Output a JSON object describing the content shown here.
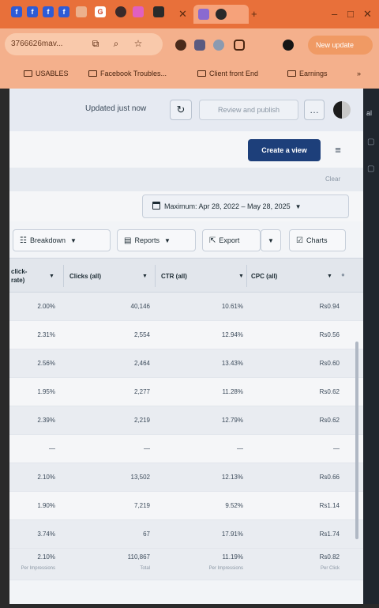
{
  "browser": {
    "url": "3766626mav...",
    "update_label": "New update",
    "bookmarks": [
      "USABLES",
      "Facebook Troubles...",
      "Client front End",
      "Earnings"
    ]
  },
  "header": {
    "status": "Updated just now",
    "publish_label": "Review and publish",
    "more_label": "…"
  },
  "create_view_label": "Create a view",
  "clear_label": "Clear",
  "date_range": "Maximum: Apr 28, 2022 – May 28, 2025",
  "toolbar": {
    "breakdown": "Breakdown",
    "reports": "Reports",
    "export": "Export",
    "charts": "Charts"
  },
  "table": {
    "columns": [
      "click-\nrate)",
      "Clicks (all)",
      "CTR (all)",
      "CPC (all)"
    ],
    "rows": [
      [
        "2.00%",
        "40,146",
        "10.61%",
        "Rs0.94"
      ],
      [
        "2.31%",
        "2,554",
        "12.94%",
        "Rs0.56"
      ],
      [
        "2.56%",
        "2,464",
        "13.43%",
        "Rs0.60"
      ],
      [
        "1.95%",
        "2,277",
        "11.28%",
        "Rs0.62"
      ],
      [
        "2.39%",
        "2,219",
        "12.79%",
        "Rs0.62"
      ],
      [
        "—",
        "—",
        "—",
        "—"
      ],
      [
        "2.10%",
        "13,502",
        "12.13%",
        "Rs0.66"
      ],
      [
        "1.90%",
        "7,219",
        "9.52%",
        "Rs1.14"
      ],
      [
        "3.74%",
        "67",
        "17.91%",
        "Rs1.74"
      ]
    ],
    "totals": [
      "2.10%",
      "110,867",
      "11.19%",
      "Rs0.82"
    ],
    "totals_sub": [
      "Per Impressions",
      "Total",
      "Per Impressions",
      "Per Click"
    ]
  },
  "sidebar_right": {
    "label": "al"
  }
}
